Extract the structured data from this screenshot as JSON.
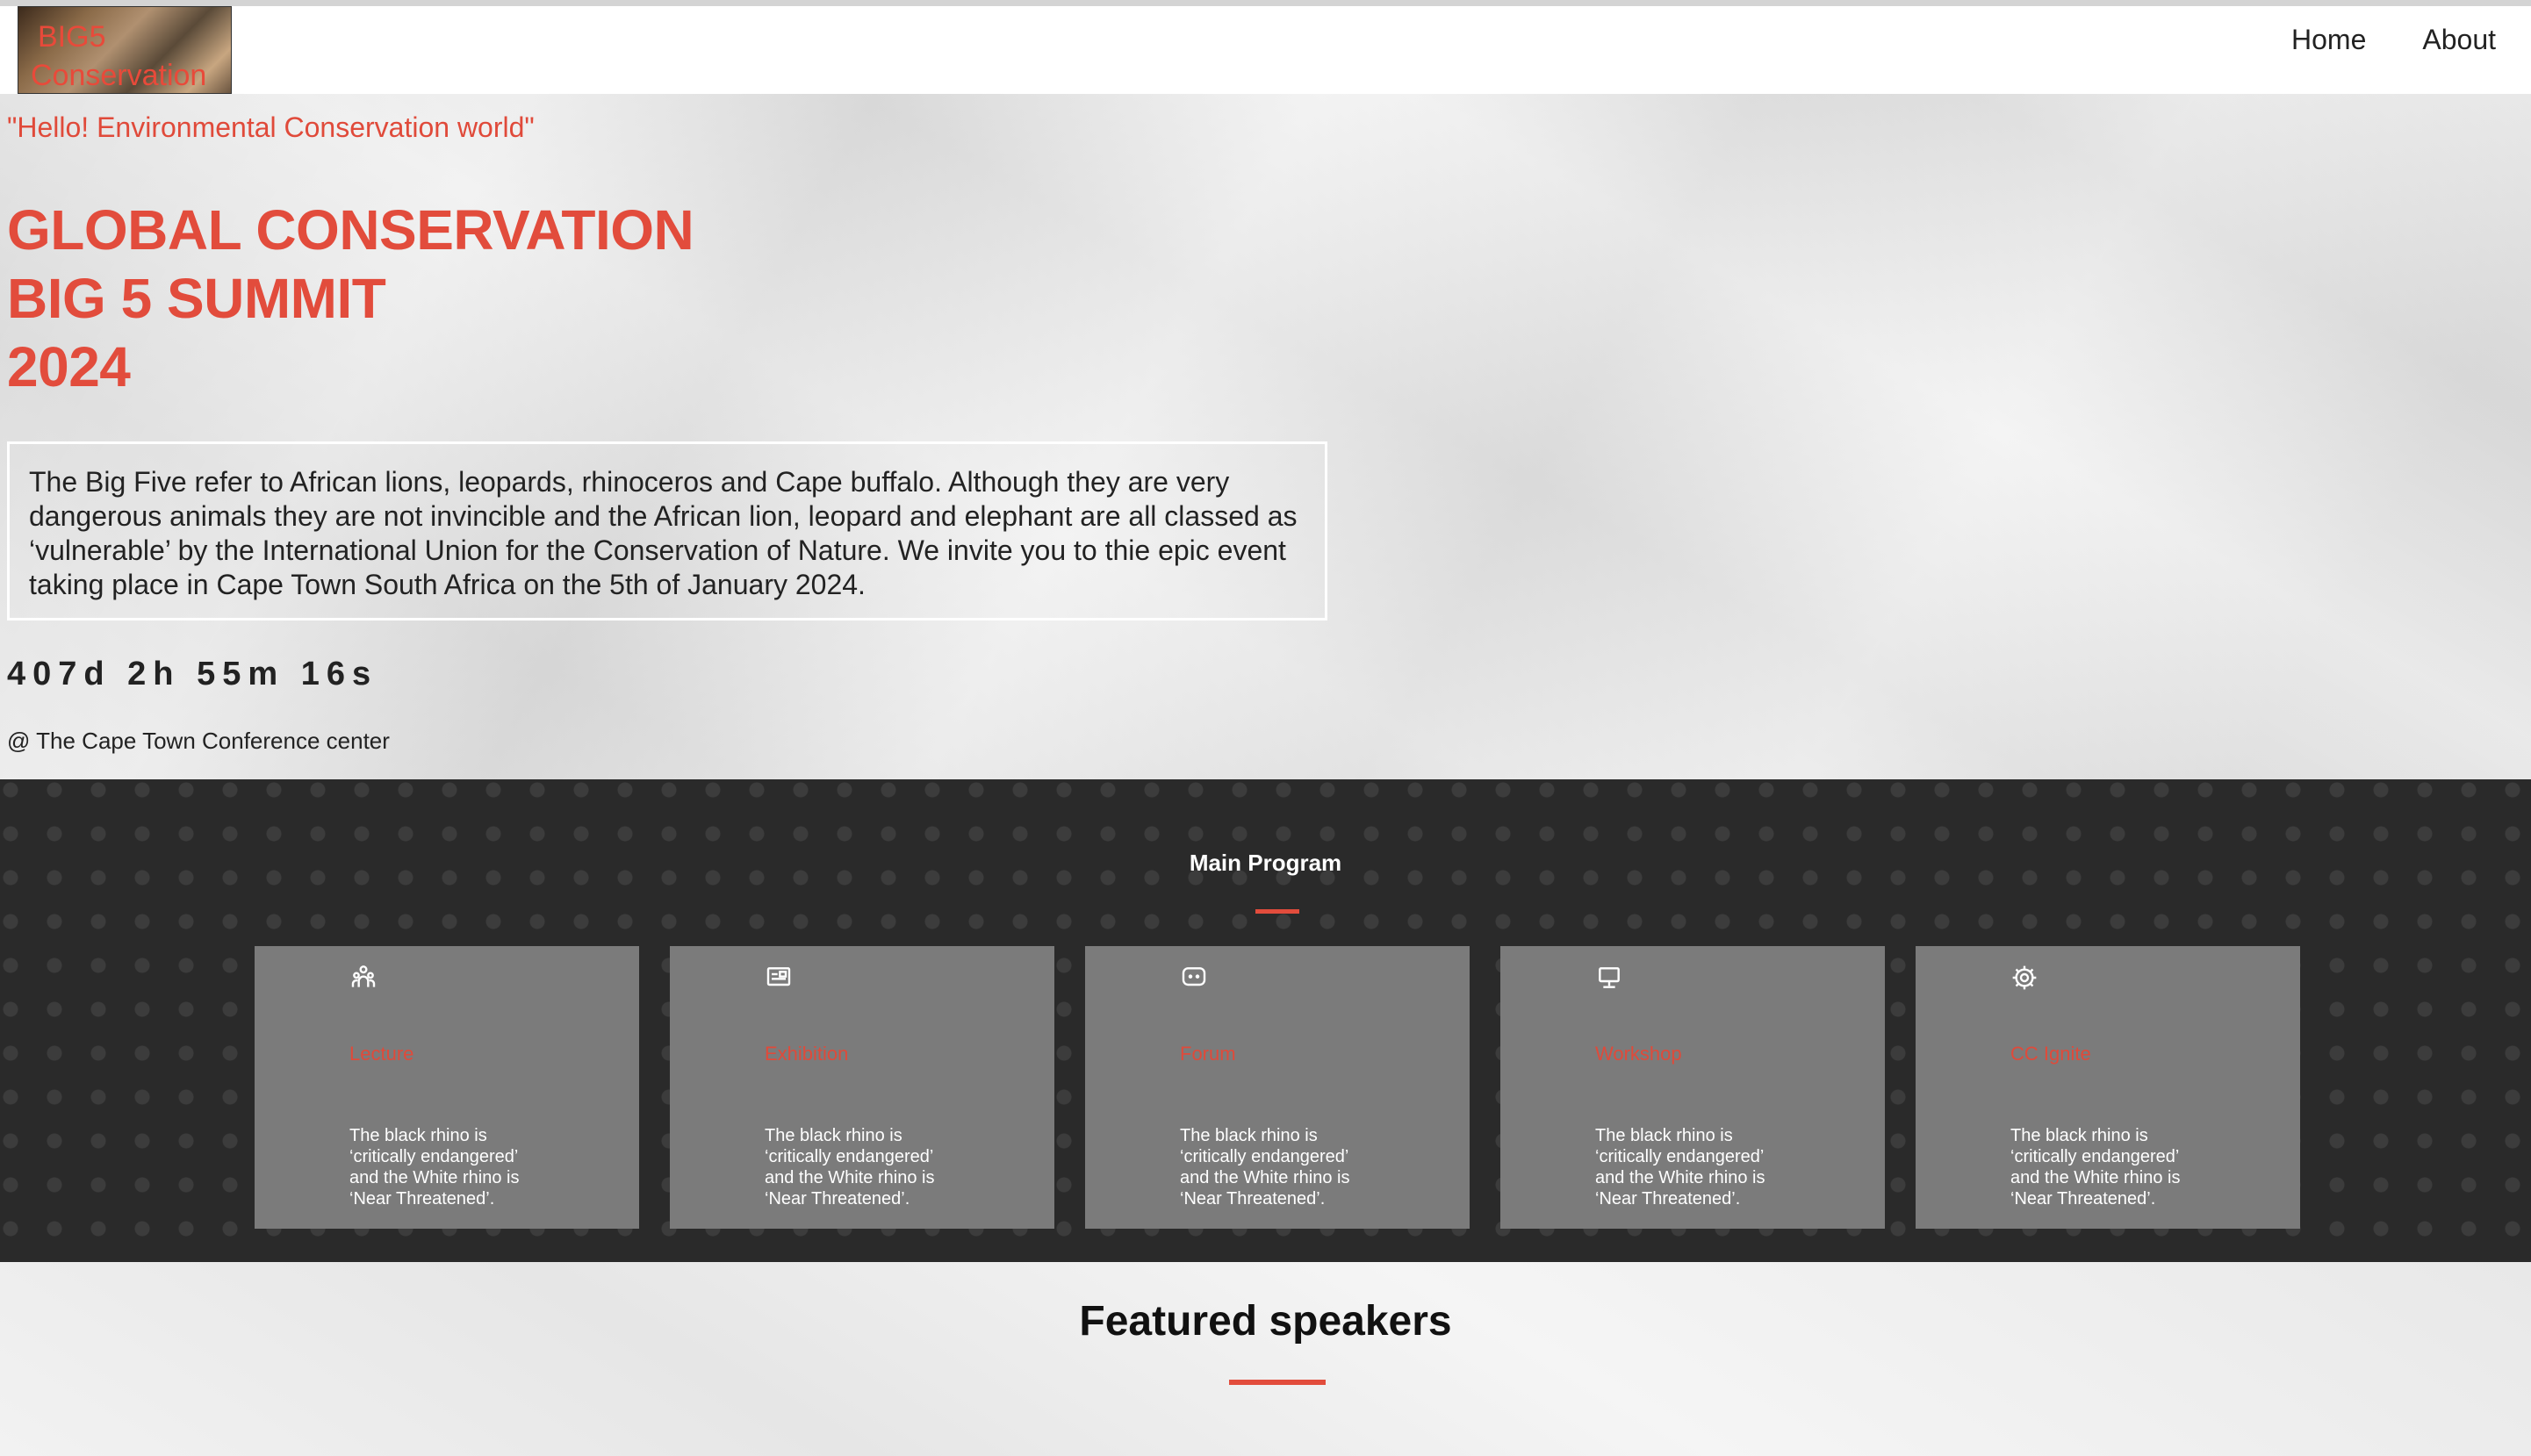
{
  "nav": {
    "logo_line1": "BIG5",
    "logo_line2": "Conservation",
    "links": [
      "Home",
      "About"
    ]
  },
  "hero": {
    "tagline": "\"Hello! Environmental Conservation world\"",
    "title_lines": [
      "GLOBAL CONSERVATION",
      "BIG 5 SUMMIT",
      "2024"
    ],
    "description": "The Big Five refer to African lions, leopards, rhinoceros and Cape buffalo. Although they are very dangerous animals they are not invincible and the African lion, leopard and elephant are all classed as ‘vulnerable’ by the International Union for the Conservation of Nature. We invite you to thie epic event taking place in Cape Town South Africa on the 5th of January 2024.",
    "countdown": "407d 2h 55m 16s",
    "venue": "@ The Cape Town Conference center"
  },
  "program": {
    "title": "Main Program",
    "accent_color": "#e24c3c",
    "cards": [
      {
        "icon": "people-icon",
        "title": "Lecture",
        "text": "The black rhino is ‘critically endangered’ and the White rhino is ‘Near Threatened’."
      },
      {
        "icon": "presentation-icon",
        "title": "Exhibition",
        "text": "The black rhino is ‘critically endangered’ and the White rhino is ‘Near Threatened’."
      },
      {
        "icon": "chat-icon",
        "title": "Forum",
        "text": "The black rhino is ‘critically endangered’ and the White rhino is ‘Near Threatened’."
      },
      {
        "icon": "monitor-icon",
        "title": "Workshop",
        "text": "The black rhino is ‘critically endangered’ and the White rhino is ‘Near Threatened’."
      },
      {
        "icon": "gear-icon",
        "title": "CC Ignite",
        "text": "The black rhino is ‘critically endangered’ and the White rhino is ‘Near Threatened’."
      }
    ]
  },
  "speakers": {
    "title": "Featured speakers"
  }
}
